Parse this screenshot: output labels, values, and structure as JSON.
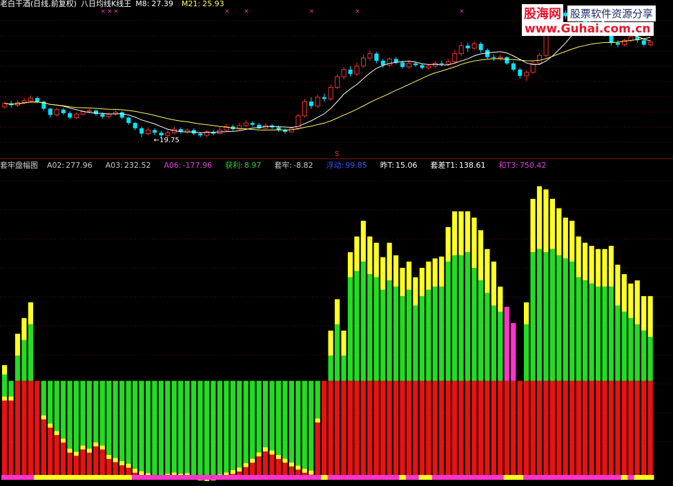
{
  "top_panel": {
    "title": "老白干酒(日线,前复权)",
    "indicator_name": "八日均线K线王",
    "m8_label": "M8:",
    "m8_value": "27.39",
    "m21_label": "M21:",
    "m21_value": "25.93",
    "low_marker": "←19.75",
    "s_marker": "S"
  },
  "bottom_panel": {
    "indicator_name": "套牢盘幅图",
    "items": [
      {
        "label": "A02:",
        "value": "277.96",
        "color": "#cccccc"
      },
      {
        "label": "A03:",
        "value": "232.52",
        "color": "#cccccc"
      },
      {
        "label": "A06:",
        "value": "-177.96",
        "color": "#e040e0"
      },
      {
        "label": "获利:",
        "value": "8.97",
        "color": "#33cc33"
      },
      {
        "label": "套牢:",
        "value": "-8.82",
        "color": "#cccccc"
      },
      {
        "label": "浮动:",
        "value": "99.85",
        "color": "#3355ff"
      },
      {
        "label": "昨T:",
        "value": "15.06",
        "color": "#ffffff"
      },
      {
        "label": "套差T1:",
        "value": "138.61",
        "color": "#ffffff"
      },
      {
        "label": "和T3:",
        "value": "750.42",
        "color": "#e040e0"
      }
    ]
  },
  "watermark": {
    "line1a": "股海网",
    "line1b": "股票软件资源分享",
    "line2": "www.Guhai.com.cn"
  },
  "colors": {
    "bull": "#ff3030",
    "bear": "#00e5ff",
    "ma_fast": "#ffffff",
    "ma_slow": "#ffff66",
    "red": "#e81212",
    "green": "#22dd22",
    "yellow": "#ffff22",
    "magenta": "#ff33cc",
    "grid": "#7a1a1a"
  },
  "chart_data": [
    {
      "type": "candlestick",
      "title": "老白干酒(日线,前复权)",
      "price_range": [
        18.5,
        34.5
      ],
      "candles": [
        [
          23.4,
          23.8,
          24.0,
          23.2
        ],
        [
          23.8,
          23.6,
          24.1,
          23.3
        ],
        [
          23.6,
          23.9,
          24.2,
          23.4
        ],
        [
          23.9,
          24.1,
          24.4,
          23.7
        ],
        [
          24.1,
          24.4,
          24.7,
          23.9
        ],
        [
          24.4,
          24.0,
          24.6,
          23.8
        ],
        [
          24.0,
          23.2,
          24.1,
          23.0
        ],
        [
          23.2,
          22.5,
          23.3,
          22.2
        ],
        [
          22.5,
          23.1,
          23.3,
          22.3
        ],
        [
          23.1,
          22.7,
          23.3,
          22.5
        ],
        [
          22.7,
          22.2,
          22.9,
          22.0
        ],
        [
          22.2,
          22.6,
          22.8,
          22.0
        ],
        [
          22.6,
          22.9,
          23.1,
          22.4
        ],
        [
          22.9,
          23.0,
          23.2,
          22.7
        ],
        [
          23.0,
          22.6,
          23.1,
          22.4
        ],
        [
          22.6,
          22.3,
          22.8,
          22.1
        ],
        [
          22.3,
          22.6,
          22.8,
          22.1
        ],
        [
          22.6,
          22.8,
          23.0,
          22.4
        ],
        [
          22.8,
          22.2,
          22.9,
          22.0
        ],
        [
          22.2,
          21.6,
          22.3,
          21.4
        ],
        [
          21.6,
          21.0,
          21.7,
          20.8
        ],
        [
          21.0,
          20.4,
          21.2,
          20.0
        ],
        [
          20.4,
          20.8,
          21.1,
          20.2
        ],
        [
          20.8,
          20.5,
          21.0,
          20.2
        ],
        [
          20.5,
          20.2,
          20.7,
          19.9
        ],
        [
          20.2,
          20.5,
          20.8,
          19.75
        ],
        [
          20.5,
          20.9,
          21.2,
          20.3
        ],
        [
          20.9,
          20.6,
          21.1,
          20.4
        ],
        [
          20.6,
          20.8,
          21.0,
          20.4
        ],
        [
          20.8,
          20.4,
          21.0,
          20.2
        ],
        [
          20.4,
          20.2,
          20.6,
          20.0
        ],
        [
          20.2,
          20.6,
          20.8,
          20.0
        ],
        [
          20.6,
          20.4,
          20.8,
          20.2
        ],
        [
          20.4,
          20.8,
          21.1,
          20.3
        ],
        [
          20.8,
          21.2,
          21.5,
          20.6
        ],
        [
          21.2,
          20.9,
          21.4,
          20.7
        ],
        [
          20.9,
          21.3,
          21.6,
          20.8
        ],
        [
          21.3,
          21.6,
          21.9,
          21.1
        ],
        [
          21.6,
          21.4,
          21.8,
          21.2
        ],
        [
          21.4,
          21.0,
          21.6,
          20.9
        ],
        [
          21.0,
          21.3,
          21.6,
          20.9
        ],
        [
          21.3,
          21.1,
          21.5,
          20.9
        ],
        [
          21.1,
          20.8,
          21.3,
          20.6
        ],
        [
          20.8,
          20.6,
          21.0,
          20.4
        ],
        [
          20.6,
          21.0,
          21.2,
          20.5
        ],
        [
          21.0,
          22.4,
          22.6,
          20.8
        ],
        [
          22.4,
          24.0,
          24.3,
          22.2
        ],
        [
          24.0,
          23.5,
          24.5,
          23.2
        ],
        [
          23.5,
          24.5,
          24.8,
          23.3
        ],
        [
          24.5,
          24.3,
          24.9,
          24.0
        ],
        [
          24.3,
          25.6,
          25.9,
          24.1
        ],
        [
          25.6,
          26.8,
          27.1,
          25.4
        ],
        [
          26.8,
          27.6,
          27.9,
          26.5
        ],
        [
          27.6,
          27.1,
          28.0,
          26.8
        ],
        [
          27.1,
          28.0,
          28.4,
          26.9
        ],
        [
          28.0,
          28.9,
          29.3,
          27.8
        ],
        [
          28.9,
          29.4,
          29.8,
          28.6
        ],
        [
          29.4,
          28.6,
          29.6,
          28.3
        ],
        [
          28.6,
          28.1,
          28.8,
          27.8
        ],
        [
          28.1,
          28.8,
          29.0,
          27.9
        ],
        [
          28.8,
          28.4,
          29.0,
          28.2
        ],
        [
          28.4,
          27.9,
          28.6,
          27.7
        ],
        [
          27.9,
          28.3,
          28.6,
          27.7
        ],
        [
          28.3,
          28.1,
          28.5,
          27.9
        ],
        [
          28.1,
          27.8,
          28.3,
          27.6
        ],
        [
          27.8,
          28.0,
          28.2,
          27.6
        ],
        [
          28.0,
          28.3,
          28.5,
          27.8
        ],
        [
          28.3,
          28.2,
          28.6,
          28.0
        ],
        [
          28.2,
          28.5,
          28.8,
          28.0
        ],
        [
          28.5,
          29.4,
          29.8,
          28.3
        ],
        [
          29.4,
          30.3,
          30.7,
          29.1
        ],
        [
          30.3,
          30.0,
          30.6,
          29.6
        ],
        [
          30.0,
          30.5,
          30.8,
          29.8
        ],
        [
          30.5,
          29.8,
          30.7,
          29.5
        ],
        [
          29.8,
          29.0,
          30.0,
          28.8
        ],
        [
          29.0,
          28.9,
          29.3,
          28.6
        ],
        [
          28.9,
          29.0,
          29.3,
          28.6
        ],
        [
          29.0,
          28.3,
          29.1,
          28.1
        ],
        [
          28.3,
          27.6,
          28.5,
          27.4
        ],
        [
          27.6,
          26.9,
          27.8,
          26.6
        ],
        [
          26.9,
          27.3,
          27.5,
          26.3
        ],
        [
          27.3,
          28.3,
          28.6,
          27.1
        ],
        [
          28.3,
          29.2,
          29.5,
          28.1
        ],
        [
          29.2,
          32.0,
          32.6,
          29.0
        ],
        [
          32.0,
          33.5,
          34.0,
          31.8
        ],
        [
          33.5,
          34.0,
          34.4,
          33.2
        ],
        [
          34.0,
          33.6,
          34.3,
          33.3
        ],
        [
          33.6,
          33.9,
          34.2,
          33.4
        ],
        [
          33.9,
          33.2,
          34.1,
          32.9
        ],
        [
          33.2,
          32.1,
          33.3,
          31.9
        ],
        [
          32.1,
          32.8,
          33.1,
          31.8
        ],
        [
          32.8,
          32.3,
          33.0,
          32.0
        ],
        [
          32.3,
          31.5,
          32.6,
          31.3
        ],
        [
          31.5,
          30.6,
          31.7,
          30.3
        ],
        [
          30.6,
          30.4,
          30.9,
          30.1
        ],
        [
          30.4,
          30.9,
          31.1,
          30.2
        ],
        [
          30.9,
          31.3,
          31.6,
          30.7
        ],
        [
          31.3,
          30.9,
          31.5,
          30.6
        ],
        [
          30.9,
          30.4,
          31.1,
          30.2
        ],
        [
          30.4,
          30.7,
          30.9,
          30.2
        ]
      ]
    },
    {
      "type": "bar",
      "title": "套牢盘幅图",
      "y_range": [
        -150,
        345
      ],
      "baseline": 0,
      "red": [
        53,
        80,
        80,
        80,
        80,
        80,
        80,
        80,
        80,
        80,
        80,
        80,
        80,
        80,
        80,
        80,
        80,
        80,
        80,
        80,
        80,
        80,
        80,
        80,
        80,
        80,
        80,
        80,
        80,
        80,
        80,
        80,
        80,
        80,
        80,
        80,
        80,
        80,
        80,
        80,
        80,
        80,
        80,
        80,
        80,
        80,
        80,
        80,
        80,
        80,
        80,
        80,
        80,
        80,
        80,
        80,
        80,
        80,
        80,
        80,
        80,
        80,
        80,
        80,
        80,
        80,
        80,
        80,
        80,
        80,
        80,
        80,
        80,
        80,
        80,
        80,
        80,
        80,
        80,
        80,
        80,
        80,
        80,
        80,
        80,
        80,
        80,
        80,
        80,
        80,
        80,
        80,
        80,
        80,
        80,
        80,
        80,
        80,
        80,
        80
      ],
      "values": [
        [
          -25,
          10,
          15
        ],
        [
          -25,
          0,
          20
        ],
        [
          0,
          40,
          35
        ],
        [
          0,
          65,
          35
        ],
        [
          0,
          90,
          35
        ],
        [
          0,
          0,
          0
        ],
        [
          -55,
          0,
          0
        ],
        [
          -68,
          0,
          0
        ],
        [
          -80,
          0,
          0
        ],
        [
          -92,
          0,
          0
        ],
        [
          -108,
          0,
          0
        ],
        [
          -113,
          0,
          0
        ],
        [
          -103,
          0,
          0
        ],
        [
          -108,
          0,
          0
        ],
        [
          -98,
          0,
          0
        ],
        [
          -103,
          0,
          0
        ],
        [
          -118,
          0,
          0
        ],
        [
          -123,
          0,
          0
        ],
        [
          -128,
          0,
          0
        ],
        [
          -132,
          0,
          0
        ],
        [
          -140,
          0,
          0
        ],
        [
          -144,
          0,
          0
        ],
        [
          -147,
          0,
          0
        ],
        [
          -150,
          0,
          0
        ],
        [
          -150,
          0,
          0
        ],
        [
          -148,
          0,
          0
        ],
        [
          -146,
          0,
          0
        ],
        [
          -148,
          0,
          0
        ],
        [
          -147,
          0,
          0
        ],
        [
          -151,
          0,
          0
        ],
        [
          -152,
          0,
          0
        ],
        [
          -153,
          0,
          0
        ],
        [
          -152,
          0,
          0
        ],
        [
          -149,
          0,
          0
        ],
        [
          -146,
          0,
          0
        ],
        [
          -142,
          0,
          0
        ],
        [
          -138,
          0,
          0
        ],
        [
          -131,
          0,
          0
        ],
        [
          -124,
          0,
          0
        ],
        [
          -114,
          0,
          0
        ],
        [
          -106,
          0,
          0
        ],
        [
          -111,
          0,
          0
        ],
        [
          -118,
          0,
          0
        ],
        [
          -124,
          0,
          0
        ],
        [
          -130,
          0,
          0
        ],
        [
          -135,
          0,
          0
        ],
        [
          -140,
          0,
          0
        ],
        [
          -143,
          0,
          0
        ],
        [
          -60,
          0,
          0
        ],
        [
          0,
          0,
          0
        ],
        [
          0,
          40,
          40
        ],
        [
          0,
          90,
          40
        ],
        [
          0,
          40,
          40
        ],
        [
          0,
          165,
          40
        ],
        [
          0,
          175,
          55
        ],
        [
          0,
          190,
          65
        ],
        [
          0,
          170,
          60
        ],
        [
          0,
          165,
          55
        ],
        [
          0,
          145,
          52
        ],
        [
          0,
          160,
          60
        ],
        [
          0,
          150,
          50
        ],
        [
          0,
          135,
          45
        ],
        [
          0,
          145,
          45
        ],
        [
          0,
          120,
          45
        ],
        [
          0,
          135,
          45
        ],
        [
          0,
          145,
          45
        ],
        [
          0,
          150,
          45
        ],
        [
          0,
          150,
          48
        ],
        [
          0,
          190,
          55
        ],
        [
          0,
          200,
          70
        ],
        [
          0,
          200,
          70
        ],
        [
          0,
          205,
          65
        ],
        [
          0,
          180,
          80
        ],
        [
          0,
          160,
          80
        ],
        [
          0,
          140,
          70
        ],
        [
          0,
          120,
          70
        ],
        [
          0,
          110,
          40
        ],
        [
          0,
          0,
          0
        ],
        [
          0,
          0,
          0
        ],
        [
          0,
          0,
          0
        ],
        [
          0,
          90,
          35
        ],
        [
          0,
          205,
          85
        ],
        [
          0,
          210,
          100
        ],
        [
          0,
          205,
          100
        ],
        [
          0,
          210,
          80
        ],
        [
          0,
          200,
          75
        ],
        [
          0,
          195,
          65
        ],
        [
          0,
          190,
          65
        ],
        [
          0,
          165,
          65
        ],
        [
          0,
          160,
          60
        ],
        [
          0,
          155,
          60
        ],
        [
          0,
          150,
          60
        ],
        [
          0,
          150,
          60
        ],
        [
          0,
          150,
          65
        ],
        [
          0,
          120,
          65
        ],
        [
          0,
          110,
          60
        ],
        [
          0,
          100,
          55
        ],
        [
          0,
          90,
          70
        ],
        [
          0,
          80,
          55
        ],
        [
          0,
          70,
          65
        ]
      ],
      "magenta_cols": [
        77,
        78
      ],
      "magenta_values": [
        118,
        92
      ]
    }
  ]
}
